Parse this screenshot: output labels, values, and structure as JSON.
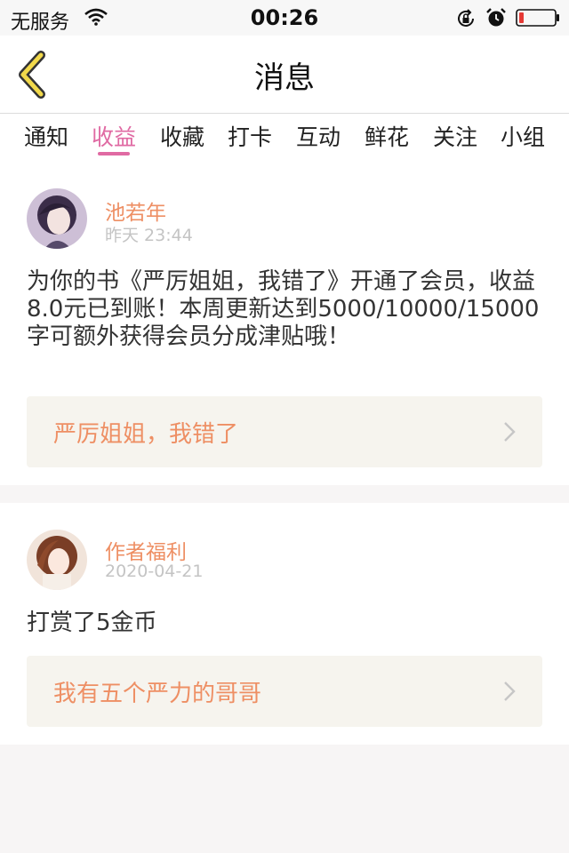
{
  "status_bar": {
    "carrier": "无服务",
    "time": "00:26",
    "icons": [
      "wifi-icon",
      "rotation-lock-icon",
      "alarm-icon",
      "battery-icon"
    ],
    "battery_color": "#e53935"
  },
  "header": {
    "title": "消息",
    "back_icon": "chevron-left-icon",
    "back_color": "#f2d94b"
  },
  "tabs": {
    "items": [
      {
        "label": "通知"
      },
      {
        "label": "收益"
      },
      {
        "label": "收藏"
      },
      {
        "label": "打卡"
      },
      {
        "label": "互动"
      },
      {
        "label": "鲜花"
      },
      {
        "label": "关注"
      },
      {
        "label": "小组"
      }
    ],
    "active_index": 1,
    "active_color": "#e06aa3"
  },
  "messages": [
    {
      "sender": "池若年",
      "time": "昨天 23:44",
      "text": "为你的书《严厉姐姐，我错了》开通了会员，收益8.0元已到账！本周更新达到5000/10000/15000字可额外获得会员分成津贴哦！",
      "link_label": "严厉姐姐，我错了",
      "link_icon": "chevron-right-icon"
    },
    {
      "sender": "作者福利",
      "time": "2020-04-21",
      "text": "打赏了5金币",
      "link_label": "我有五个严力的哥哥",
      "link_icon": "chevron-right-icon"
    }
  ],
  "accent_color": "#ee8f64"
}
